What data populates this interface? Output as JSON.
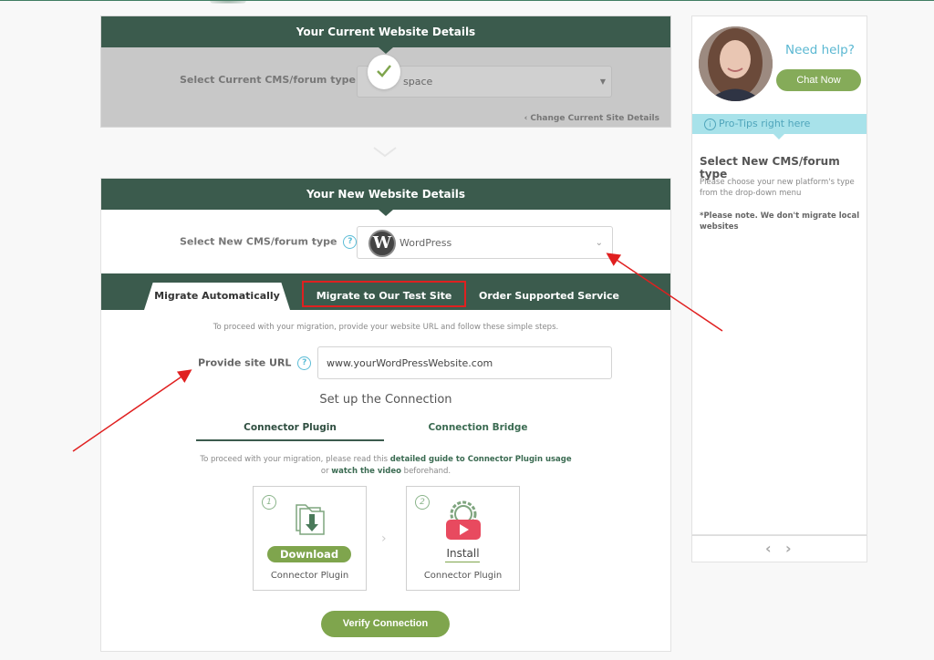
{
  "current_panel": {
    "title": "Your Current Website Details",
    "select_label": "Select Current CMS/forum type",
    "selected_value": "space",
    "change_link": "Change Current Site Details"
  },
  "new_panel": {
    "title": "Your New Website Details",
    "select_label": "Select New CMS/forum type",
    "help_glyph": "?",
    "selected_value": "WordPress",
    "selected_logo_glyph": "W",
    "tabs": [
      {
        "label": "Migrate Automatically",
        "active": true
      },
      {
        "label": "Migrate to Our Test Site",
        "active": false,
        "highlighted": true
      },
      {
        "label": "Order Supported Service",
        "active": false
      }
    ],
    "intro": "To proceed with your migration, provide your website URL and follow these simple steps.",
    "url_label": "Provide site URL",
    "url_value": "www.yourWordPressWebsite.com",
    "setup_title": "Set up the Connection",
    "subtabs": [
      {
        "label": "Connector Plugin",
        "active": true
      },
      {
        "label": "Connection Bridge",
        "active": false
      }
    ],
    "guide": {
      "prefix": "To proceed with your migration, please read this ",
      "guide_link": "detailed guide to Connector Plugin usage",
      "middle": "or ",
      "video_link": "watch the video",
      "suffix": " beforehand."
    },
    "steps": [
      {
        "number": "1",
        "action": "Download",
        "subtitle": "Connector Plugin",
        "icon": "folder-download-icon"
      },
      {
        "number": "2",
        "action": "Install",
        "subtitle": "Connector Plugin",
        "icon": "gear-video-icon"
      }
    ],
    "verify_button": "Verify Connection"
  },
  "sidebar": {
    "need_help": "Need help?",
    "chat_button": "Chat Now",
    "protips_icon": "i",
    "protips_label": "Pro-Tips right here",
    "tip_title": "Select New CMS/forum type",
    "tip_body": "Please choose your new platform's type from the drop-down menu",
    "tip_note": "*Please note. We don't migrate local websites",
    "prev_glyph": "‹",
    "next_glyph": "›"
  },
  "colors": {
    "header_green": "#3b5b4d",
    "accent_green": "#7fa54d",
    "help_blue": "#5bb8d2",
    "protips_bg": "#a8e2ea",
    "annotation_red": "#e02020"
  }
}
